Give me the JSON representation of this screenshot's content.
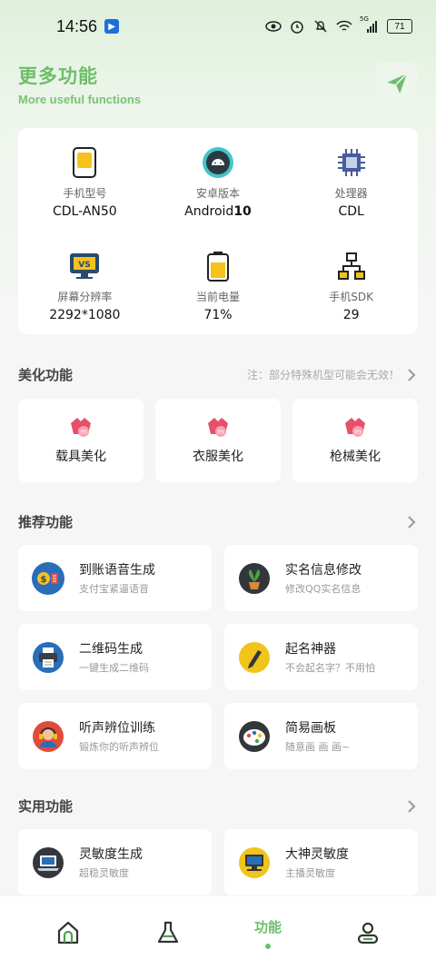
{
  "status_bar": {
    "time": "14:56",
    "battery": "71",
    "network": "5G"
  },
  "header": {
    "title": "更多功能",
    "subtitle": "More useful functions"
  },
  "device_info": [
    {
      "label": "手机型号",
      "value": "CDL-AN50",
      "icon": "phone-icon"
    },
    {
      "label": "安卓版本",
      "value_prefix": "Android",
      "value_suffix": "10",
      "icon": "android-icon"
    },
    {
      "label": "处理器",
      "value": "CDL",
      "icon": "cpu-icon"
    },
    {
      "label": "屏幕分辨率",
      "value": "2292*1080",
      "icon": "monitor-icon"
    },
    {
      "label": "当前电量",
      "value": "71%",
      "icon": "battery-icon"
    },
    {
      "label": "手机SDK",
      "value": "29",
      "icon": "network-icon"
    }
  ],
  "beautify": {
    "title": "美化功能",
    "note": "注：部分特殊机型可能会无效！",
    "items": [
      {
        "label": "载具美化"
      },
      {
        "label": "衣服美化"
      },
      {
        "label": "枪械美化"
      }
    ]
  },
  "recommended": {
    "title": "推荐功能",
    "items": [
      {
        "title": "到账语音生成",
        "subtitle": "支付宝紧逼语音",
        "icon": "payment-voice-icon"
      },
      {
        "title": "实名信息修改",
        "subtitle": "修改QQ实名信息",
        "icon": "plant-icon"
      },
      {
        "title": "二维码生成",
        "subtitle": "一键生成二维码",
        "icon": "printer-icon"
      },
      {
        "title": "起名神器",
        "subtitle": "不会起名字？不用怕",
        "icon": "pen-icon"
      },
      {
        "title": "听声辨位训练",
        "subtitle": "锻炼你的听声辨位",
        "icon": "headset-icon"
      },
      {
        "title": "简易画板",
        "subtitle": "随意画 画 画~",
        "icon": "palette-icon"
      }
    ]
  },
  "utility": {
    "title": "实用功能",
    "items": [
      {
        "title": "灵敏度生成",
        "subtitle": "超稳灵敏度",
        "icon": "laptop-icon"
      },
      {
        "title": "大神灵敏度",
        "subtitle": "主播灵敏度",
        "icon": "computer-icon"
      }
    ]
  },
  "bottom_nav": {
    "active_label": "功能"
  },
  "colors": {
    "accent": "#6fbd6a",
    "beauty_icon": "#e8506a"
  }
}
